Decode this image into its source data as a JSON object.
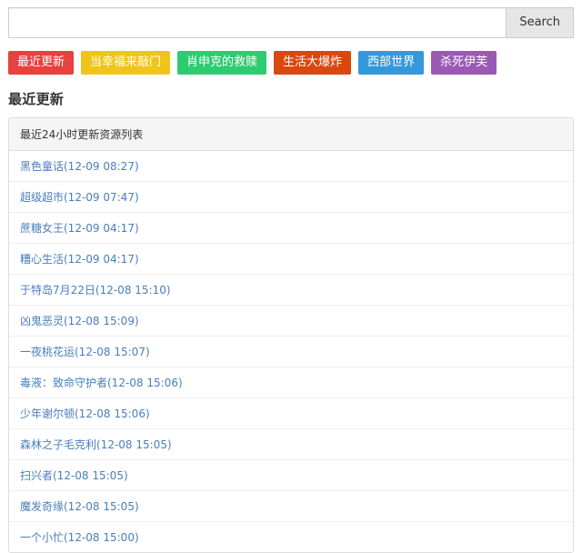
{
  "search": {
    "value": "",
    "placeholder": "",
    "button_label": "Search"
  },
  "tags": [
    {
      "label": "最近更新",
      "color": "#e8413f"
    },
    {
      "label": "当幸福来敲门",
      "color": "#f0c419"
    },
    {
      "label": "肖申克的救赎",
      "color": "#2ecc71"
    },
    {
      "label": "生活大爆炸",
      "color": "#d9480f"
    },
    {
      "label": "西部世界",
      "color": "#3498db"
    },
    {
      "label": "杀死伊芙",
      "color": "#9b59b6"
    }
  ],
  "section": {
    "heading": "最近更新"
  },
  "panel": {
    "heading": "最近24小时更新资源列表",
    "items": [
      {
        "label": "黑色童话(12-09 08:27)"
      },
      {
        "label": "超级超市(12-09 07:47)"
      },
      {
        "label": "蔗糖女王(12-09 04:17)"
      },
      {
        "label": "糟心生活(12-09 04:17)"
      },
      {
        "label": "于特岛7月22日(12-08 15:10)"
      },
      {
        "label": "凶鬼恶灵(12-08 15:09)"
      },
      {
        "label": "一夜桃花运(12-08 15:07)"
      },
      {
        "label": "毒液：致命守护者(12-08 15:06)"
      },
      {
        "label": "少年谢尔顿(12-08 15:06)"
      },
      {
        "label": "森林之子毛克利(12-08 15:05)"
      },
      {
        "label": "扫兴者(12-08 15:05)"
      },
      {
        "label": "魔发奇缘(12-08 15:05)"
      },
      {
        "label": "一个小忙(12-08 15:00)"
      }
    ]
  },
  "colors": {
    "link": "#4a7ebb",
    "panel_border": "#dddddd",
    "panel_heading_bg": "#f5f5f5"
  }
}
